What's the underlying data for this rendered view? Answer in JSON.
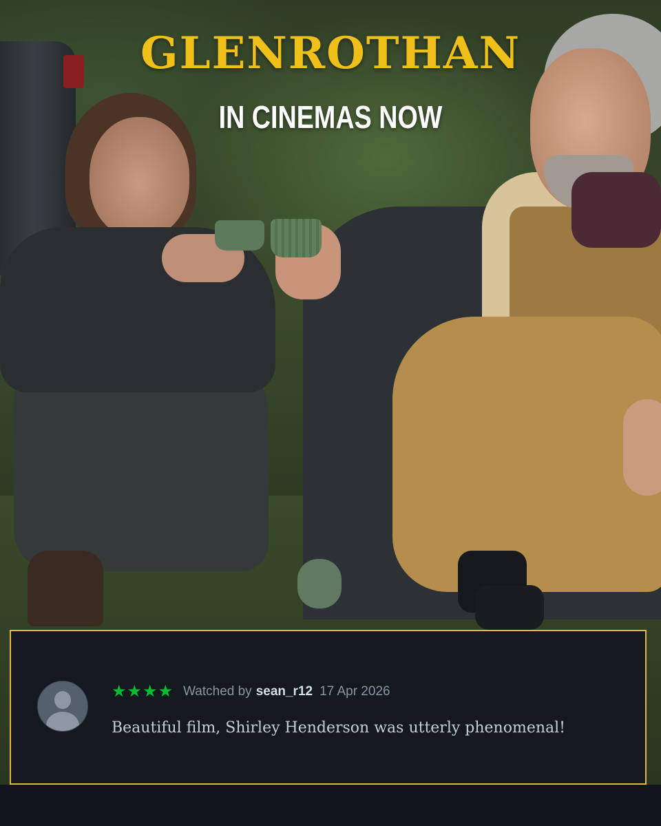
{
  "poster": {
    "title": "GLENROTHAN",
    "tagline": "IN CINEMAS NOW",
    "title_color": "#f0c01a"
  },
  "review": {
    "stars": "★★★★",
    "star_count": 4,
    "star_color": "#00c030",
    "watched_prefix": "Watched by",
    "username": "sean_r12",
    "date": "17 Apr 2026",
    "text": "Beautiful film, Shirley Henderson was utterly phenomenal!",
    "avatar_icon": "user-silhouette-icon",
    "border_color": "#e6b840"
  }
}
